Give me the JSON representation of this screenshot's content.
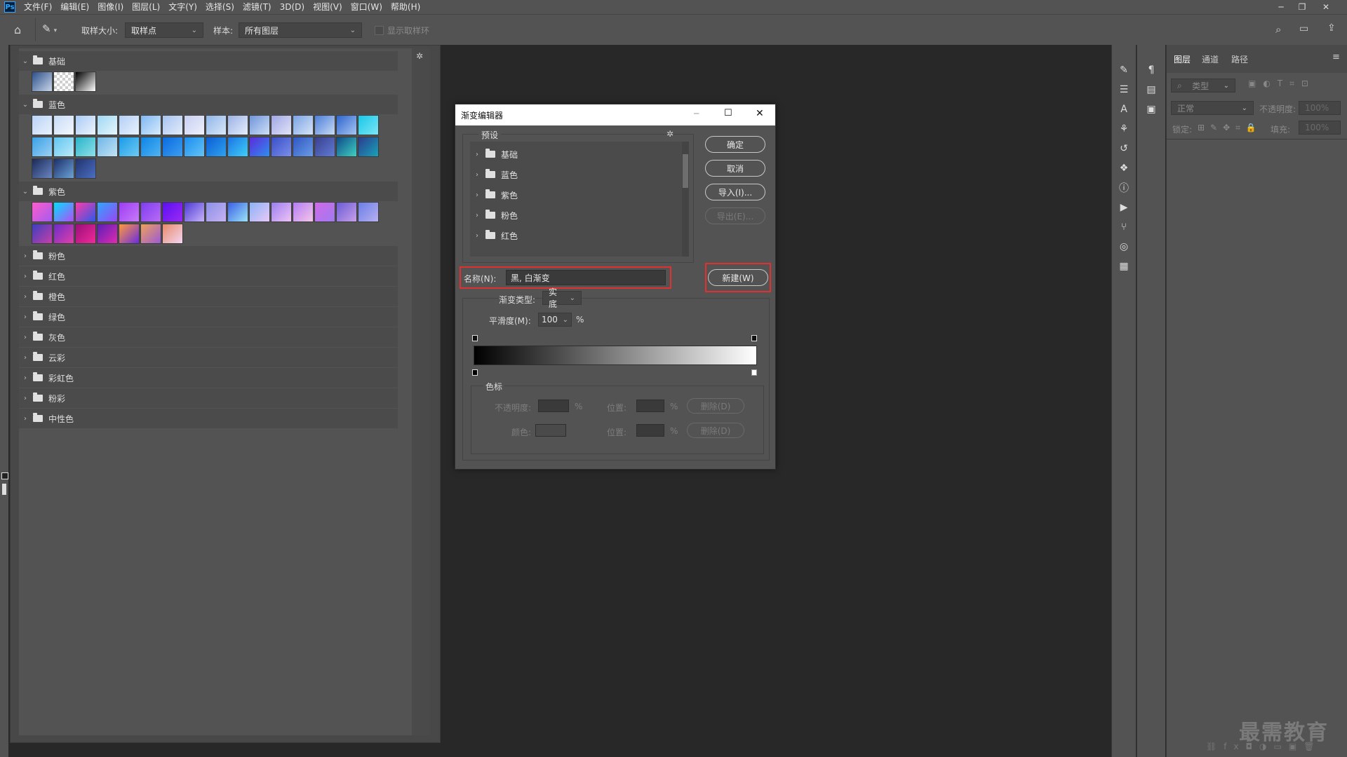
{
  "menubar": {
    "logo": "Ps",
    "items": [
      "文件(F)",
      "编辑(E)",
      "图像(I)",
      "图层(L)",
      "文字(Y)",
      "选择(S)",
      "滤镜(T)",
      "3D(D)",
      "视图(V)",
      "窗口(W)",
      "帮助(H)"
    ]
  },
  "options": {
    "sample_size_label": "取样大小:",
    "sample_size_value": "取样点",
    "sample_label": "样本:",
    "sample_value": "所有图层",
    "show_ring_label": "显示取样环"
  },
  "gradient_panel": {
    "groups": [
      {
        "name": "基础",
        "expanded": true
      },
      {
        "name": "蓝色",
        "expanded": true
      },
      {
        "name": "紫色",
        "expanded": true
      },
      {
        "name": "粉色",
        "expanded": false
      },
      {
        "name": "红色",
        "expanded": false
      },
      {
        "name": "橙色",
        "expanded": false
      },
      {
        "name": "绿色",
        "expanded": false
      },
      {
        "name": "灰色",
        "expanded": false
      },
      {
        "name": "云彩",
        "expanded": false
      },
      {
        "name": "彩虹色",
        "expanded": false
      },
      {
        "name": "粉彩",
        "expanded": false
      },
      {
        "name": "中性色",
        "expanded": false
      }
    ]
  },
  "layers_panel": {
    "tabs": [
      "图层",
      "通道",
      "路径"
    ],
    "filter_placeholder": "类型",
    "blend_mode": "正常",
    "opacity_label": "不透明度:",
    "opacity_value": "100%",
    "lock_label": "锁定:",
    "fill_label": "填充:",
    "fill_value": "100%"
  },
  "dialog": {
    "title": "渐变编辑器",
    "presets_label": "预设",
    "preset_items": [
      "基础",
      "蓝色",
      "紫色",
      "粉色",
      "红色"
    ],
    "buttons": {
      "ok": "确定",
      "cancel": "取消",
      "import": "导入(I)...",
      "export": "导出(E)...",
      "new": "新建(W)"
    },
    "name_label": "名称(N):",
    "name_value": "黑, 白渐变",
    "gradient_type_label": "渐变类型:",
    "gradient_type_value": "实底",
    "smoothness_label": "平滑度(M):",
    "smoothness_value": "100",
    "smoothness_unit": "%",
    "stops_label": "色标",
    "opacity_label": "不透明度:",
    "location_label": "位置:",
    "percent": "%",
    "delete_label": "删除(D)",
    "color_label": "颜色:"
  },
  "watermark": "最需教育"
}
